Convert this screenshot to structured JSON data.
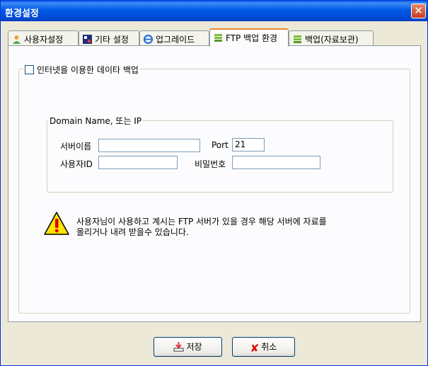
{
  "window": {
    "title": "환경설정",
    "close_label": "✕"
  },
  "tabs": [
    {
      "label": "사용자설정",
      "icon": "user-icon"
    },
    {
      "label": "기타 설정",
      "icon": "settings-icon"
    },
    {
      "label": "업그레이드",
      "icon": "ie-icon"
    },
    {
      "label": "FTP 백업 환경",
      "icon": "ftp-server-icon",
      "active": true
    },
    {
      "label": "백업(자료보관)",
      "icon": "backup-icon"
    }
  ],
  "internet_backup": {
    "label": "인터넷을 이용한 데이타 백업",
    "checked": false
  },
  "domain_group": {
    "title": "Domain Name, 또는 IP"
  },
  "fields": {
    "server_name_label": "서버이름",
    "server_name_value": "",
    "port_label": "Port",
    "port_value": "21",
    "user_id_label": "사용자ID",
    "user_id_value": "",
    "password_label": "비밀번호",
    "password_value": ""
  },
  "notice": {
    "line1": "사용자님이 사용하고 계시는 FTP 서버가 있을 경우 해당 서버에 자료를",
    "line2": "올리거나 내려 받을수 있습니다."
  },
  "buttons": {
    "save": "저장",
    "cancel": "취소"
  },
  "colors": {
    "titlebar": "#0058e6",
    "active_tab_accent": "#e68b2c",
    "dialog_bg": "#ece9d8"
  }
}
